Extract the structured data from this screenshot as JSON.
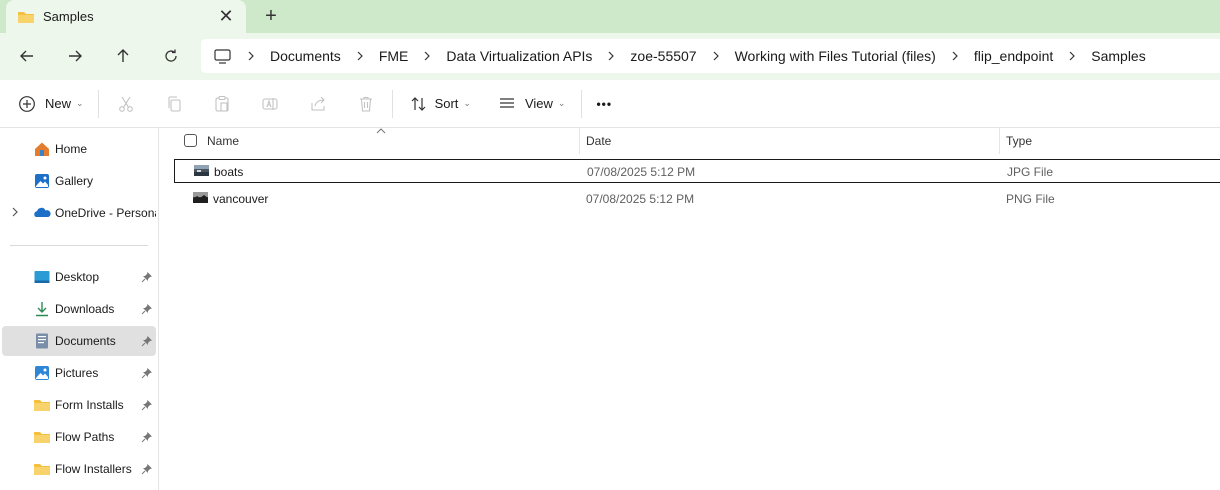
{
  "window": {
    "tab_title": "Samples",
    "tab_close": "✕",
    "new_tab": "+"
  },
  "address": {
    "crumbs": [
      "Documents",
      "FME",
      "Data Virtualization APIs",
      "zoe-55507",
      "Working with Files Tutorial (files)",
      "flip_endpoint",
      "Samples"
    ]
  },
  "toolbar": {
    "new_label": "New",
    "sort_label": "Sort",
    "view_label": "View",
    "more_label": "•••"
  },
  "sidebar": {
    "items": [
      {
        "label": "Home",
        "icon": "home-icon"
      },
      {
        "label": "Gallery",
        "icon": "gallery-icon"
      },
      {
        "label": "OneDrive - Persona",
        "icon": "onedrive-icon"
      },
      {
        "label": "Desktop",
        "icon": "desktop-icon",
        "pinned": true
      },
      {
        "label": "Downloads",
        "icon": "download-icon",
        "pinned": true
      },
      {
        "label": "Documents",
        "icon": "documents-icon",
        "pinned": true,
        "selected": true
      },
      {
        "label": "Pictures",
        "icon": "pictures-icon",
        "pinned": true
      },
      {
        "label": "Form Installs",
        "icon": "folder-icon",
        "pinned": true
      },
      {
        "label": "Flow Paths",
        "icon": "folder-icon",
        "pinned": true
      },
      {
        "label": "Flow Installers",
        "icon": "folder-icon",
        "pinned": true
      }
    ]
  },
  "files": {
    "columns": {
      "name": "Name",
      "date": "Date",
      "type": "Type"
    },
    "rows": [
      {
        "name": "boats",
        "date": "07/08/2025 5:12 PM",
        "type": "JPG File"
      },
      {
        "name": "vancouver",
        "date": "07/08/2025 5:12 PM",
        "type": "PNG File"
      }
    ]
  },
  "colors": {
    "titlebar": "#cde9c9",
    "tab": "#eef7ec",
    "folder": "#f3c13f",
    "accent": "#1e6fc8"
  }
}
